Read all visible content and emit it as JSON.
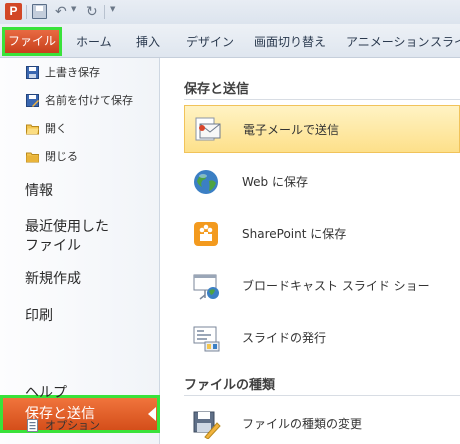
{
  "app": {
    "icon_letter": "P"
  },
  "quick_access": {
    "save_icon": "save-icon",
    "undo_glyph": "↶",
    "redo_glyph": "↻"
  },
  "ribbon": {
    "tabs": [
      {
        "label": "ファイル",
        "selected": true
      },
      {
        "label": "ホーム"
      },
      {
        "label": "挿入"
      },
      {
        "label": "デザイン"
      },
      {
        "label": "画面切り替え"
      },
      {
        "label": "アニメーション"
      },
      {
        "label": "スライ"
      }
    ]
  },
  "nav": {
    "items": [
      {
        "label": "上書き保存",
        "icon": "save-icon"
      },
      {
        "label": "名前を付けて保存",
        "icon": "save-as-icon"
      },
      {
        "label": "開く",
        "icon": "open-folder-icon"
      },
      {
        "label": "閉じる",
        "icon": "close-folder-icon"
      },
      {
        "label": "情報"
      },
      {
        "label_line1": "最近使用した",
        "label_line2": "ファイル"
      },
      {
        "label": "新規作成"
      },
      {
        "label": "印刷"
      },
      {
        "label": "保存と送信",
        "selected": true
      },
      {
        "label": "ヘルプ"
      },
      {
        "label": "オプション",
        "icon": "options-icon"
      }
    ]
  },
  "pane": {
    "section1": {
      "title": "保存と送信",
      "options": [
        {
          "label": "電子メールで送信",
          "icon": "email-icon",
          "selected": true
        },
        {
          "label": "Web に保存",
          "icon": "globe-icon"
        },
        {
          "label": "SharePoint に保存",
          "icon": "sharepoint-icon"
        },
        {
          "label": "ブロードキャスト スライド ショー",
          "icon": "broadcast-icon"
        },
        {
          "label": "スライドの発行",
          "icon": "publish-slides-icon"
        }
      ]
    },
    "section2": {
      "title": "ファイルの種類",
      "options": [
        {
          "label": "ファイルの種類の変更",
          "icon": "change-file-type-icon"
        }
      ]
    }
  },
  "colors": {
    "accent": "#d24726",
    "highlight": "#39e23a",
    "selection": "#fde08a"
  }
}
